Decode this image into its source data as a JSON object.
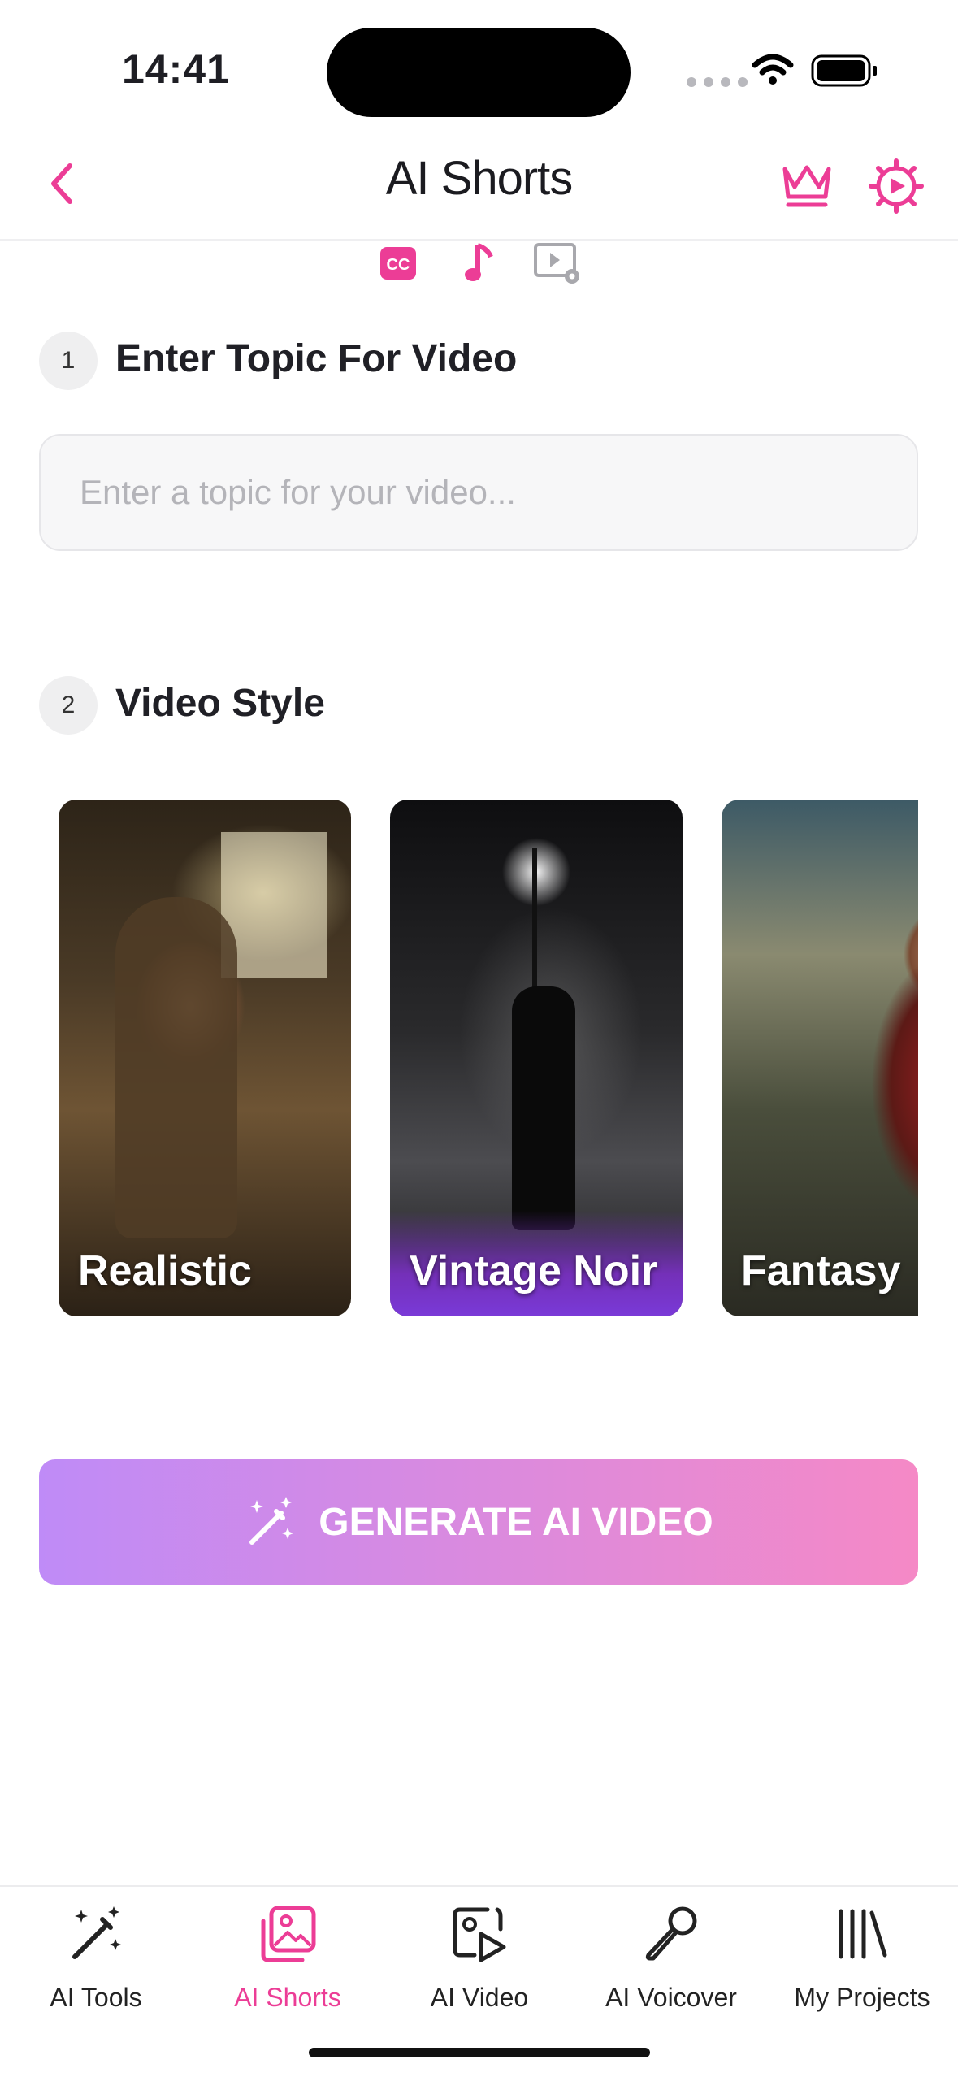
{
  "status_bar": {
    "time": "14:41"
  },
  "header": {
    "title": "AI Shorts"
  },
  "sections": {
    "topic": {
      "number": "1",
      "title": "Enter Topic For Video",
      "placeholder": "Enter a topic for your video..."
    },
    "style": {
      "number": "2",
      "title": "Video Style"
    }
  },
  "styles": [
    {
      "label": "Realistic",
      "selected": false
    },
    {
      "label": "Vintage Noir",
      "selected": true
    },
    {
      "label": "Fantasy",
      "selected": false
    }
  ],
  "generate_button": {
    "label": "GENERATE AI VIDEO"
  },
  "tabbar": {
    "items": [
      {
        "label": "AI Tools",
        "icon": "magic-wand-icon",
        "active": false
      },
      {
        "label": "AI Shorts",
        "icon": "image-gallery-icon",
        "active": true
      },
      {
        "label": "AI Video",
        "icon": "video-image-icon",
        "active": false
      },
      {
        "label": "AI Voicover",
        "icon": "microphone-icon",
        "active": false
      },
      {
        "label": "My Projects",
        "icon": "library-icon",
        "active": false
      }
    ]
  },
  "colors": {
    "accent": "#ec3d96",
    "button_start": "#bf8bf7",
    "button_end": "#f589c6",
    "selected_style": "#7a3ad8"
  }
}
